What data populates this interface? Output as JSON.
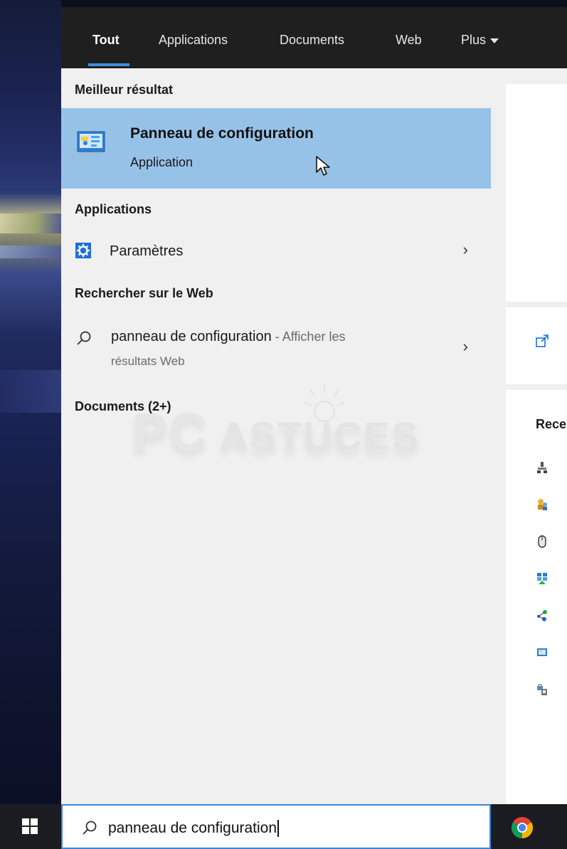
{
  "tabs": [
    {
      "label": "Tout",
      "active": true
    },
    {
      "label": "Applications"
    },
    {
      "label": "Documents"
    },
    {
      "label": "Web"
    },
    {
      "label": "Plus"
    }
  ],
  "sections": {
    "best_title": "Meilleur résultat",
    "apps_title": "Applications",
    "web_title": "Rechercher sur le Web",
    "docs_title": "Documents (2+)"
  },
  "best_result": {
    "title": "Panneau de configuration",
    "subtitle": "Application"
  },
  "apps": [
    {
      "label": "Paramètres"
    }
  ],
  "web": {
    "query": "panneau de configuration",
    "suffix": " - Afficher les",
    "line2": "résultats Web"
  },
  "watermark": {
    "pc": "PC",
    "astuces": "ASTUCES"
  },
  "preview": {
    "recent_label": "Rece"
  },
  "search": {
    "value": "panneau de configuration"
  },
  "icons": [
    "control-panel-icon",
    "gear-icon",
    "search-icon",
    "chevron-right-icon",
    "open-external-icon",
    "windows-logo-icon",
    "chrome-icon"
  ],
  "colors": {
    "highlight": "#97c2e8",
    "accent": "#3f8fe0",
    "topbar": "#1f1f1f",
    "panel": "#f0f0f0"
  }
}
